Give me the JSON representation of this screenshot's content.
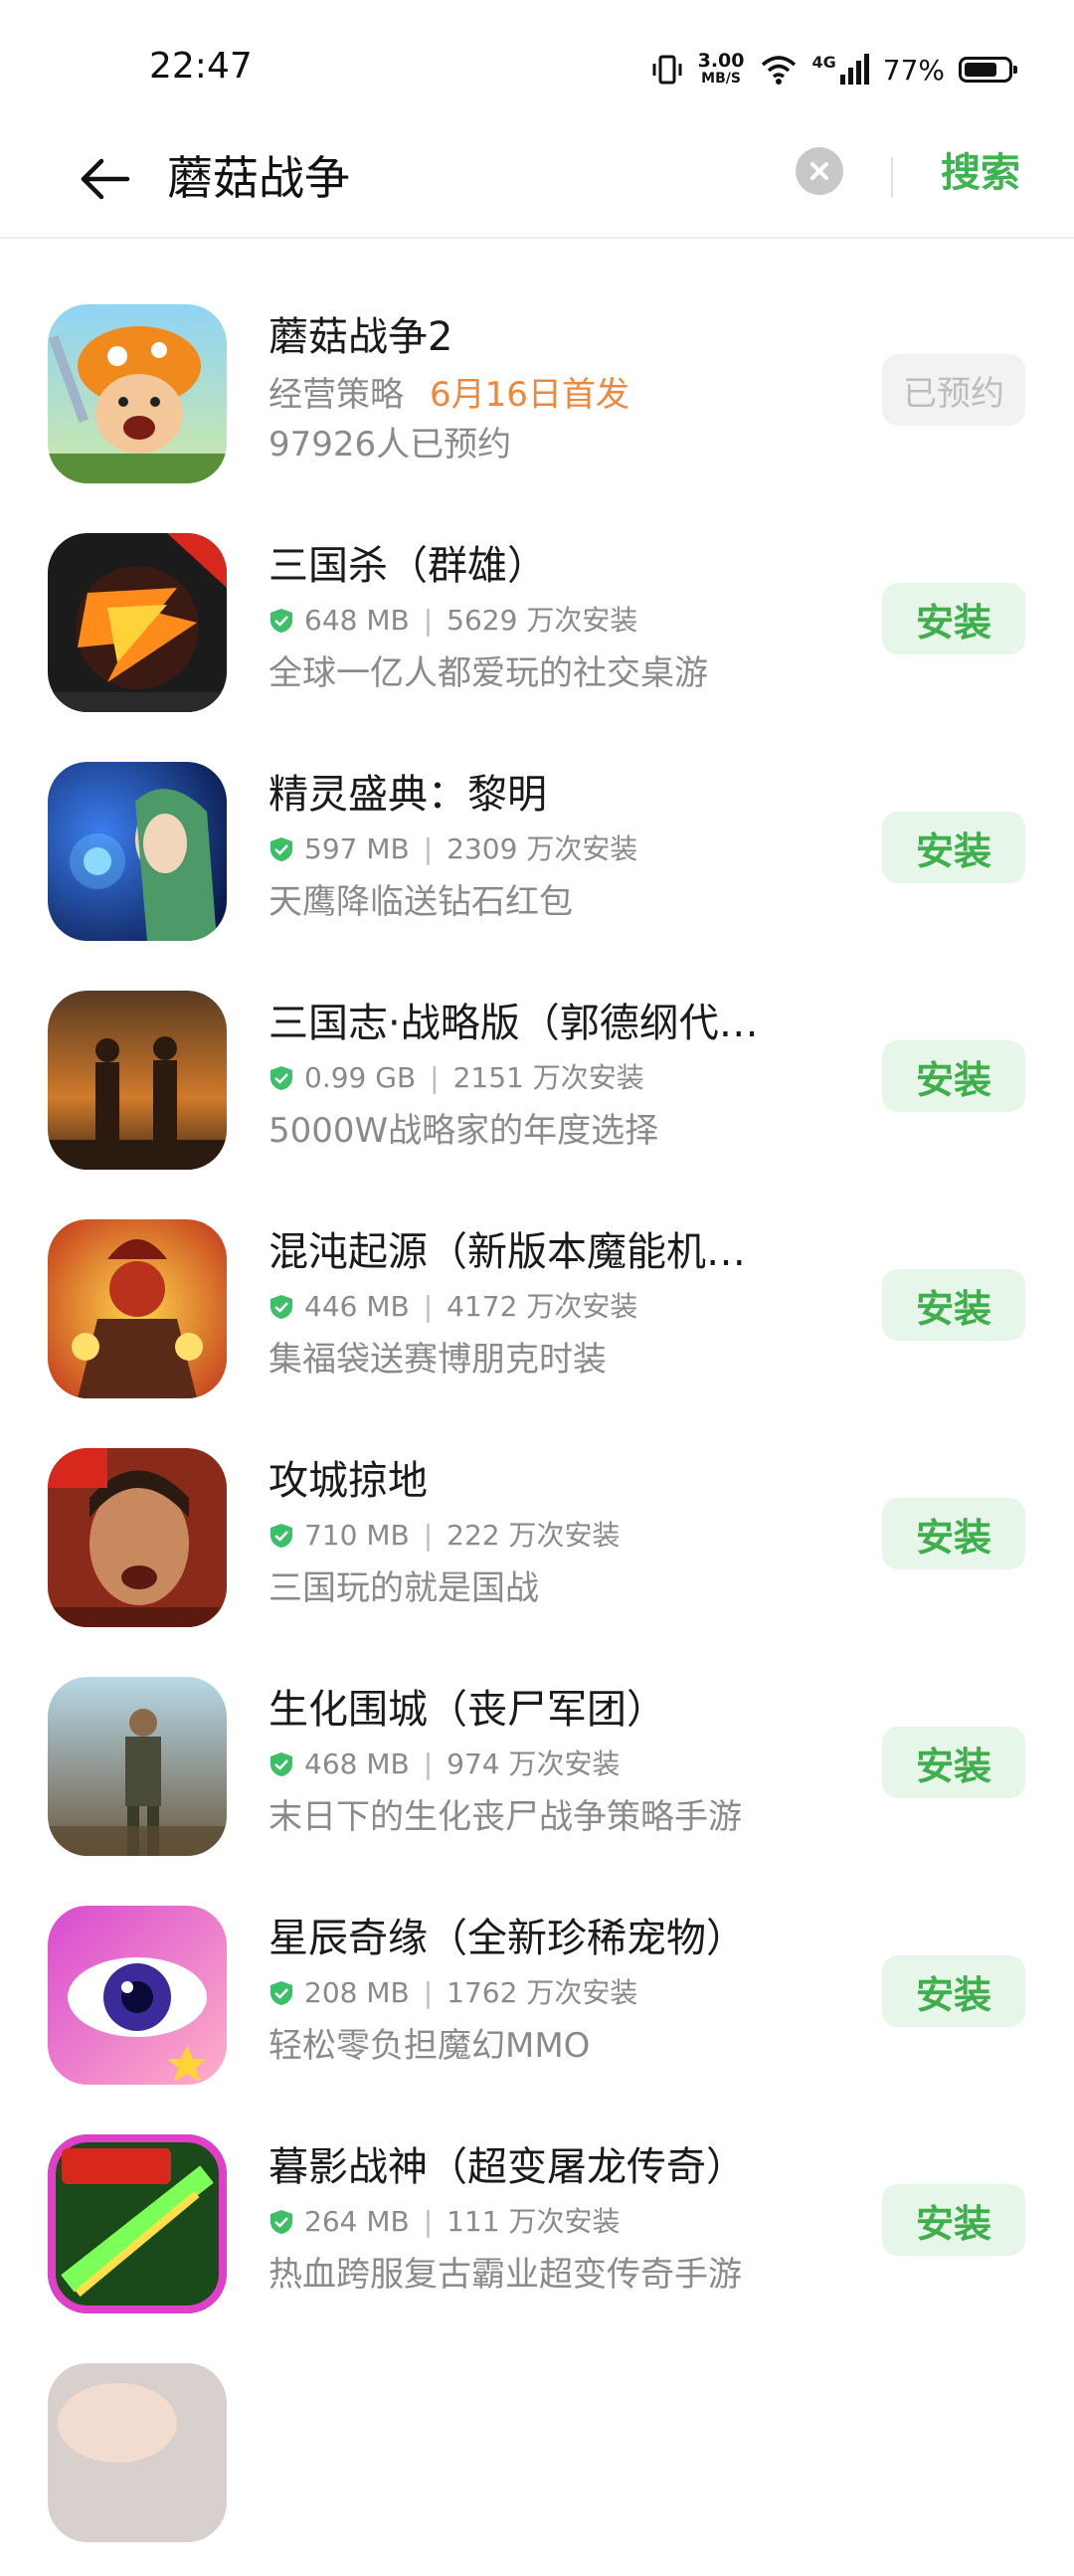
{
  "status_bar": {
    "time": "22:47",
    "net_speed_value": "3.00",
    "net_speed_unit": "MB/S",
    "network": "4G",
    "battery": "77%",
    "battery_level": 0.77
  },
  "search": {
    "query": "蘑菇战争",
    "search_label": "搜索"
  },
  "colors": {
    "accent": "#3fb34f",
    "install_bg": "#e6f6e8",
    "release_orange": "#f0873a"
  },
  "apps": [
    {
      "name": "蘑菇战争2",
      "genre": "经营策略",
      "release": "6月16日首发",
      "desc": "97926人已预约",
      "button": "已预约"
    },
    {
      "name": "三国杀（群雄）",
      "size": "648 MB",
      "installs": "5629 万次安装",
      "desc": "全球一亿人都爱玩的社交桌游",
      "button": "安装"
    },
    {
      "name": "精灵盛典：黎明",
      "size": "597 MB",
      "installs": "2309 万次安装",
      "desc": "天鹰降临送钻石红包",
      "button": "安装"
    },
    {
      "name": "三国志·战略版（郭德纲代…",
      "size": "0.99 GB",
      "installs": "2151 万次安装",
      "desc": "5000W战略家的年度选择",
      "button": "安装"
    },
    {
      "name": "混沌起源（新版本魔能机…",
      "size": "446 MB",
      "installs": "4172 万次安装",
      "desc": "集福袋送赛博朋克时装",
      "button": "安装"
    },
    {
      "name": "攻城掠地",
      "size": "710 MB",
      "installs": "222 万次安装",
      "desc": "三国玩的就是国战",
      "button": "安装"
    },
    {
      "name": "生化围城（丧尸军团）",
      "size": "468 MB",
      "installs": "974 万次安装",
      "desc": "末日下的生化丧尸战争策略手游",
      "button": "安装"
    },
    {
      "name": "星辰奇缘（全新珍稀宠物）",
      "size": "208 MB",
      "installs": "1762 万次安装",
      "desc": "轻松零负担魔幻MMO",
      "button": "安装"
    },
    {
      "name": "暮影战神（超变屠龙传奇）",
      "size": "264 MB",
      "installs": "111 万次安装",
      "desc": "热血跨服复古霸业超变传奇手游",
      "button": "安装"
    }
  ]
}
